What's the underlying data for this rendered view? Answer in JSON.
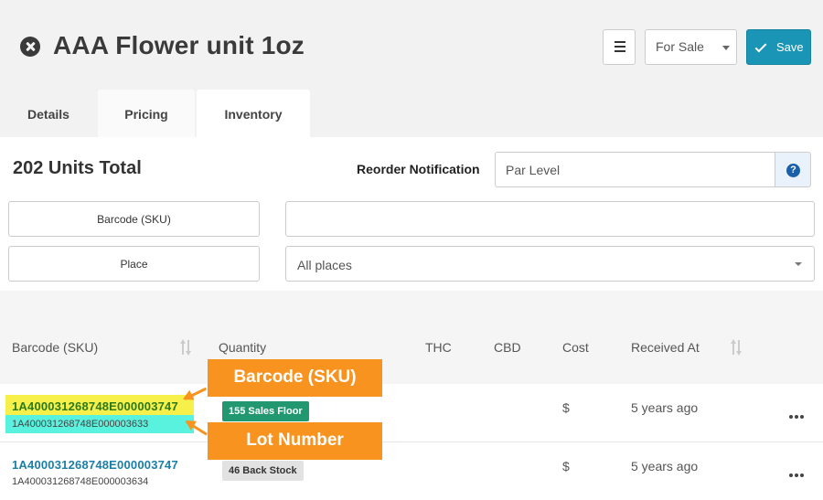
{
  "header": {
    "title": "AAA Flower unit 1oz",
    "status_value": "For Sale",
    "save_label": "Save"
  },
  "tabs": [
    {
      "label": "Details"
    },
    {
      "label": "Pricing"
    },
    {
      "label": "Inventory",
      "active": true
    }
  ],
  "inventory": {
    "units_total": "202 Units Total",
    "reorder_label": "Reorder Notification",
    "par_level_placeholder": "Par Level",
    "help_icon": "?",
    "filters": {
      "barcode_label": "Barcode (SKU)",
      "barcode_value": "",
      "place_label": "Place",
      "place_value": "All places"
    }
  },
  "table": {
    "columns": [
      "Barcode (SKU)",
      "Quantity",
      "THC",
      "CBD",
      "Cost",
      "Received At"
    ],
    "rows": [
      {
        "barcode": "1A400031268748E000003747",
        "lot": "1A400031268748E000003633",
        "quantity": "155 Sales Floor",
        "thc": "",
        "cbd": "",
        "cost": "$",
        "received": "5 years ago"
      },
      {
        "barcode": "1A400031268748E000003747",
        "lot": "1A400031268748E000003634",
        "quantity": "46 Back Stock",
        "thc": "",
        "cbd": "",
        "cost": "$",
        "received": "5 years ago"
      }
    ]
  },
  "annotations": {
    "barcode_callout": "Barcode (SKU)",
    "lot_callout": "Lot Number",
    "color": "#f7931e"
  },
  "colors": {
    "accent": "#1a95b6",
    "badge_green": "#229870",
    "link": "#1a7fa8"
  }
}
